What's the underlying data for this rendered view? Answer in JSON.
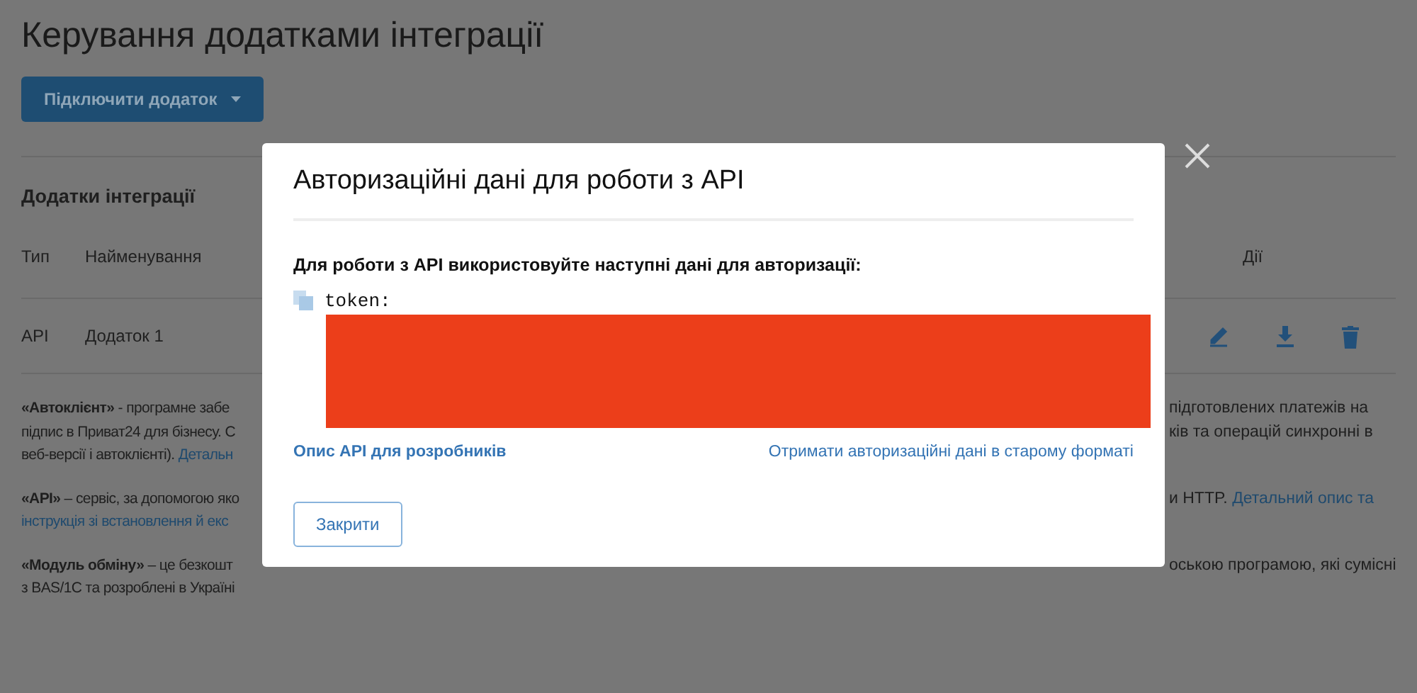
{
  "page": {
    "title": "Керування додатками інтеграції",
    "connect_button": "Підключити додаток",
    "section_title": "Додатки інтеграції",
    "table": {
      "columns": [
        {
          "label": "Тип"
        },
        {
          "label": "Найменування"
        },
        {
          "label": "Дії"
        }
      ],
      "rows": [
        {
          "type": "API",
          "name": "Додаток 1"
        }
      ]
    },
    "paragraphs": [
      {
        "lines": [
          {
            "left": {
              "text": "**«Автоклієнт»** - програмне забе"
            },
            "right": {
              "text": "підготовлених платежів на"
            }
          },
          {
            "left": {
              "text": "підпис в Приват24 для бізнесу. С"
            },
            "right": {
              "text": "ків та операцій синхронні в"
            }
          },
          {
            "left": {
              "text": "веб-версії і автоклієнті). ",
              "link": "Детальн"
            }
          }
        ]
      },
      {
        "lines": [
          {
            "left": {
              "text": "**«API»** – сервіс, за допомогою яко"
            },
            "right": {
              "text": "и HTTP. ",
              "link": "Детальний опис та"
            }
          },
          {
            "left": {
              "link": "інструкція зі встановлення й екс"
            }
          }
        ]
      },
      {
        "lines": [
          {
            "left": {
              "text": "**«Модуль обміну»** – це безкошт"
            },
            "right": {
              "text": "оською програмою, які сумісні"
            }
          },
          {
            "left": {
              "text": "з BAS/1С та розроблені в Україні"
            }
          }
        ]
      }
    ]
  },
  "modal": {
    "title": "Авторизаційні дані для роботи з API",
    "instruction": "Для роботи з API використовуйте наступні дані для авторизації:",
    "token": {
      "label": "token:",
      "redacted": true
    },
    "links": [
      {
        "label": "Опис API для розробників",
        "kind": "bold"
      },
      {
        "label": "Отримати авторизаційні дані в старому форматі",
        "kind": "plain"
      }
    ],
    "close_button": "Закрити"
  }
}
